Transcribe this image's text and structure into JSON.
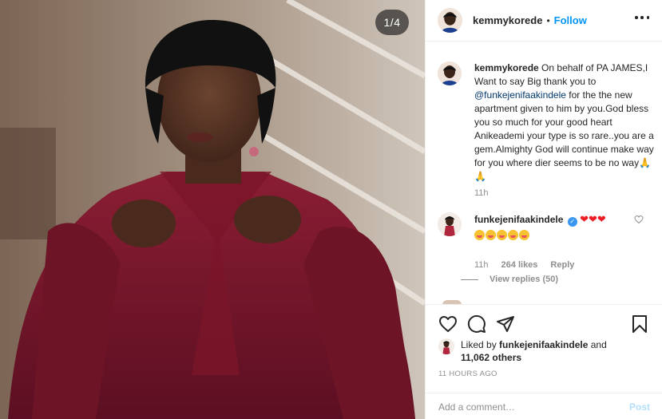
{
  "media": {
    "counter": "1/4"
  },
  "header": {
    "username": "kemmykorede",
    "dot": "•",
    "follow_label": "Follow"
  },
  "caption": {
    "username": "kemmykorede",
    "text_before": " On behalf of PA JAMES,I Want to say Big thank you to ",
    "mention": "@funkejenifaakindele",
    "text_after": " for the the new apartment given to him by you.God bless you so much for your good heart Anikeademi your type is so rare..you are a gem.Almighty God will continue make way for you where dier seems to be no way🙏🙏",
    "time": "11h"
  },
  "comment": {
    "username": "funkejenifaakindele",
    "verified_mark": "✓",
    "hearts": "❤❤❤",
    "time": "11h",
    "likes": "264 likes",
    "reply": "Reply"
  },
  "view_replies": "View replies (50)",
  "likes": {
    "prefix": "Liked by ",
    "user": "funkejenifaakindele",
    "middle": " and",
    "others": "11,062 others"
  },
  "timestamp": "11 HOURS AGO",
  "add_comment": {
    "placeholder": "Add a comment…",
    "post_label": "Post"
  },
  "icons": {
    "like": "heart-icon",
    "comment": "comment-bubble-icon",
    "share": "paper-plane-icon",
    "save": "bookmark-icon",
    "more": "more-horizontal-icon",
    "comment_like": "small-heart-icon"
  },
  "colors": {
    "accent": "#0095f6",
    "mention": "#00376b",
    "muted": "#8e8e8e",
    "post_disabled": "#b2dffc"
  }
}
